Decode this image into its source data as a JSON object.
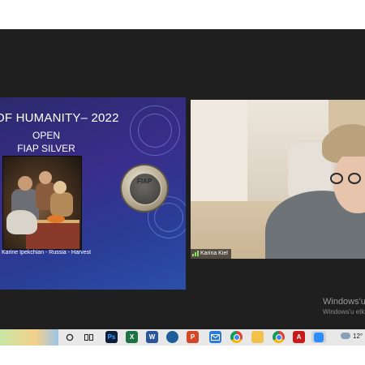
{
  "slide": {
    "title": "OF HUMANITY– 2022",
    "line1": "OPEN",
    "line2": "FIAP SILVER",
    "caption": "Karine Ipekchian - Russia - Harvest",
    "medal_text": "FIAP"
  },
  "video": {
    "participant_name": "Karina Kiel"
  },
  "watermark": {
    "line1": "Windows'u",
    "line2": "Windows'u etk"
  },
  "taskbar": {
    "apps": [
      {
        "name": "search",
        "label": ""
      },
      {
        "name": "task-view",
        "label": ""
      },
      {
        "name": "photoshop",
        "label": "Ps",
        "color": "#0d1e3c"
      },
      {
        "name": "excel",
        "label": "X",
        "color": "#1e7145"
      },
      {
        "name": "word",
        "label": "W",
        "color": "#2b579a"
      },
      {
        "name": "network",
        "label": "",
        "color": "#1f5f99"
      },
      {
        "name": "powerpoint",
        "label": "P",
        "color": "#d24726"
      },
      {
        "name": "mail",
        "label": "",
        "color": "#2a7bd6"
      },
      {
        "name": "chrome",
        "label": "",
        "color": "#db4437"
      },
      {
        "name": "explorer",
        "label": "",
        "color": "#f2c14a"
      },
      {
        "name": "chrome-2",
        "label": "",
        "color": "#db4437"
      },
      {
        "name": "acrobat",
        "label": "A",
        "color": "#c8191b"
      },
      {
        "name": "zoom",
        "label": "",
        "color": "#2d8cff"
      }
    ],
    "temperature": "12°"
  }
}
